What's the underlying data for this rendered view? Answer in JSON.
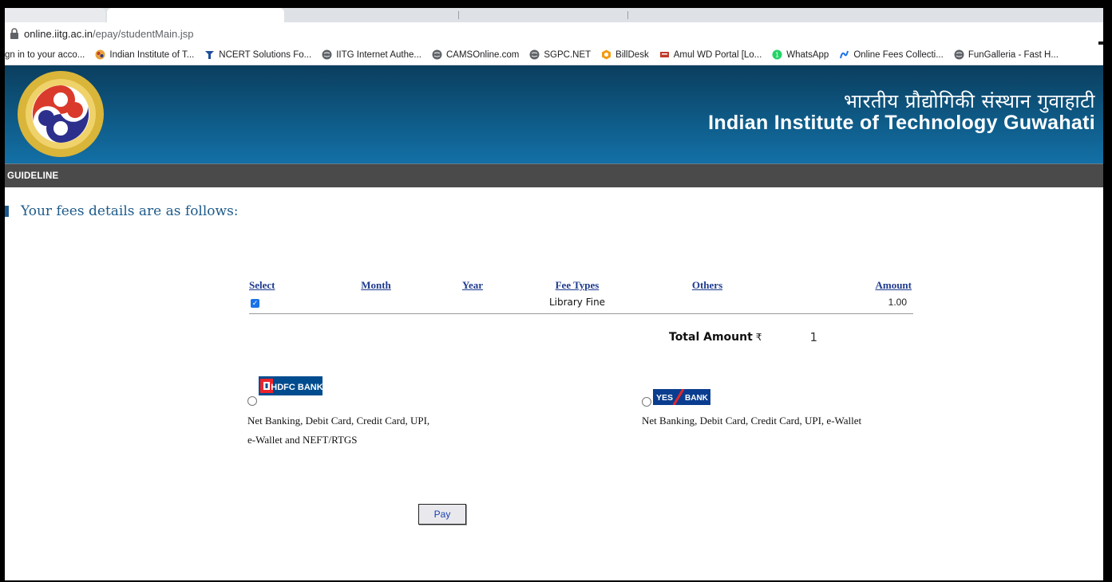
{
  "browser": {
    "url_host": "online.iitg.ac.in",
    "url_path": "/epay/studentMain.jsp",
    "bookmarks": [
      {
        "label": "gn in to your acco...",
        "icon": "none"
      },
      {
        "label": "Indian Institute of T...",
        "icon": "iitg-icon"
      },
      {
        "label": "NCERT Solutions Fo...",
        "icon": "ncert-icon"
      },
      {
        "label": "IITG Internet Authe...",
        "icon": "globe-icon"
      },
      {
        "label": "CAMSOnline.com",
        "icon": "globe-icon"
      },
      {
        "label": "SGPC.NET",
        "icon": "globe-icon"
      },
      {
        "label": "BillDesk",
        "icon": "billdesk-icon"
      },
      {
        "label": "Amul WD Portal [Lo...",
        "icon": "amul-icon"
      },
      {
        "label": "WhatsApp",
        "icon": "whatsapp-icon"
      },
      {
        "label": "Online Fees Collecti...",
        "icon": "fees-icon"
      },
      {
        "label": "FunGalleria - Fast H...",
        "icon": "globe-icon"
      }
    ]
  },
  "header": {
    "title_hindi": "भारतीय प्रौद्योगिकी संस्थान गुवाहाटी",
    "title_english": "Indian Institute of Technology  Guwahati"
  },
  "nav": {
    "items": [
      "GUIDELINE"
    ]
  },
  "main": {
    "heading": "Your fees details are as follows:",
    "table": {
      "columns": [
        "Select",
        "Month",
        "Year",
        "Fee Types",
        "Others",
        "Amount"
      ],
      "rows": [
        {
          "selected": true,
          "month": "",
          "year": "",
          "fee_type": "Library Fine",
          "others": "",
          "amount": "1.00"
        }
      ]
    },
    "total_label": "Total Amount",
    "currency_symbol": "₹",
    "total_value": "1",
    "banks": [
      {
        "name": "HDFC BANK",
        "desc_line1": "Net Banking, Debit Card, Credit Card, UPI,",
        "desc_line2": "e-Wallet and NEFT/RTGS"
      },
      {
        "name_part1": "YES",
        "name_part2": "BANK",
        "desc_line1": "Net Banking, Debit Card, Credit Card, UPI, e-Wallet"
      }
    ],
    "pay_label": "Pay"
  },
  "colors": {
    "banner": "#0e5a86",
    "navbar": "#4a4a4a",
    "heading": "#1d5b8b",
    "table_header": "#1f3b8f",
    "hdfc": "#004c8f",
    "yes": "#0a3d8f"
  }
}
